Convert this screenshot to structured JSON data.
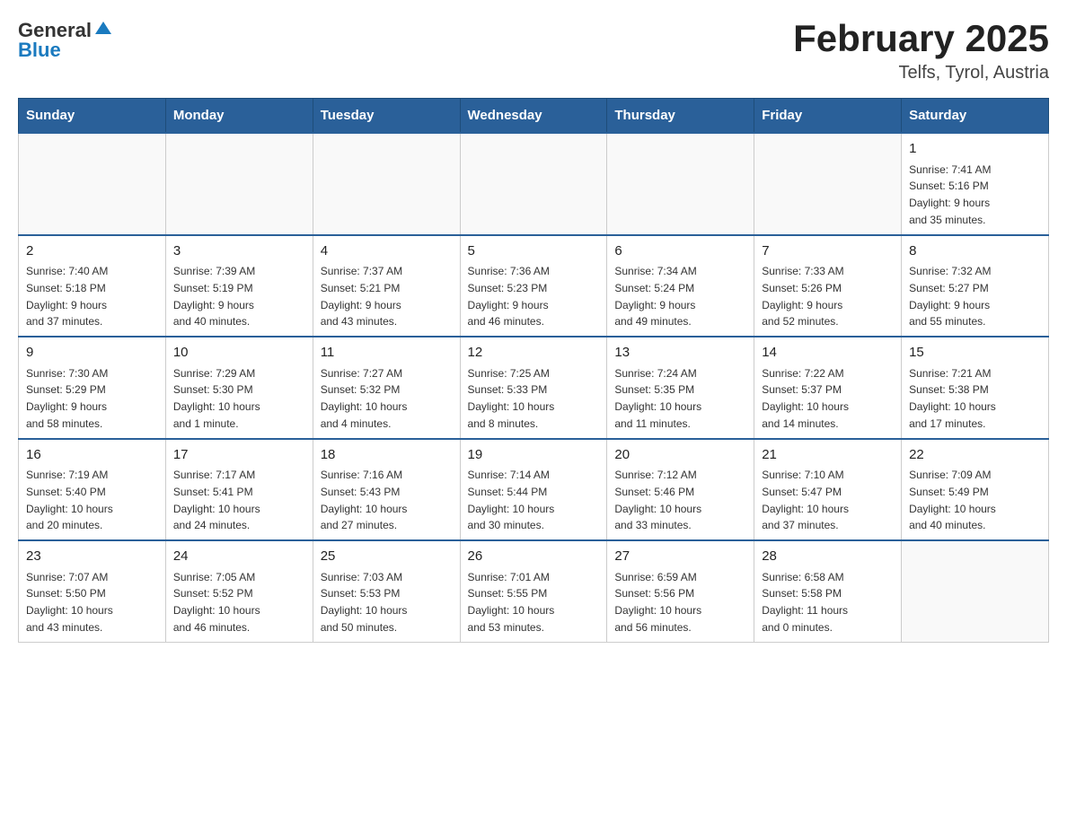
{
  "header": {
    "logo": {
      "general": "General",
      "blue": "Blue"
    },
    "title": "February 2025",
    "location": "Telfs, Tyrol, Austria"
  },
  "days_of_week": [
    "Sunday",
    "Monday",
    "Tuesday",
    "Wednesday",
    "Thursday",
    "Friday",
    "Saturday"
  ],
  "weeks": [
    [
      {
        "day": "",
        "info": ""
      },
      {
        "day": "",
        "info": ""
      },
      {
        "day": "",
        "info": ""
      },
      {
        "day": "",
        "info": ""
      },
      {
        "day": "",
        "info": ""
      },
      {
        "day": "",
        "info": ""
      },
      {
        "day": "1",
        "info": "Sunrise: 7:41 AM\nSunset: 5:16 PM\nDaylight: 9 hours\nand 35 minutes."
      }
    ],
    [
      {
        "day": "2",
        "info": "Sunrise: 7:40 AM\nSunset: 5:18 PM\nDaylight: 9 hours\nand 37 minutes."
      },
      {
        "day": "3",
        "info": "Sunrise: 7:39 AM\nSunset: 5:19 PM\nDaylight: 9 hours\nand 40 minutes."
      },
      {
        "day": "4",
        "info": "Sunrise: 7:37 AM\nSunset: 5:21 PM\nDaylight: 9 hours\nand 43 minutes."
      },
      {
        "day": "5",
        "info": "Sunrise: 7:36 AM\nSunset: 5:23 PM\nDaylight: 9 hours\nand 46 minutes."
      },
      {
        "day": "6",
        "info": "Sunrise: 7:34 AM\nSunset: 5:24 PM\nDaylight: 9 hours\nand 49 minutes."
      },
      {
        "day": "7",
        "info": "Sunrise: 7:33 AM\nSunset: 5:26 PM\nDaylight: 9 hours\nand 52 minutes."
      },
      {
        "day": "8",
        "info": "Sunrise: 7:32 AM\nSunset: 5:27 PM\nDaylight: 9 hours\nand 55 minutes."
      }
    ],
    [
      {
        "day": "9",
        "info": "Sunrise: 7:30 AM\nSunset: 5:29 PM\nDaylight: 9 hours\nand 58 minutes."
      },
      {
        "day": "10",
        "info": "Sunrise: 7:29 AM\nSunset: 5:30 PM\nDaylight: 10 hours\nand 1 minute."
      },
      {
        "day": "11",
        "info": "Sunrise: 7:27 AM\nSunset: 5:32 PM\nDaylight: 10 hours\nand 4 minutes."
      },
      {
        "day": "12",
        "info": "Sunrise: 7:25 AM\nSunset: 5:33 PM\nDaylight: 10 hours\nand 8 minutes."
      },
      {
        "day": "13",
        "info": "Sunrise: 7:24 AM\nSunset: 5:35 PM\nDaylight: 10 hours\nand 11 minutes."
      },
      {
        "day": "14",
        "info": "Sunrise: 7:22 AM\nSunset: 5:37 PM\nDaylight: 10 hours\nand 14 minutes."
      },
      {
        "day": "15",
        "info": "Sunrise: 7:21 AM\nSunset: 5:38 PM\nDaylight: 10 hours\nand 17 minutes."
      }
    ],
    [
      {
        "day": "16",
        "info": "Sunrise: 7:19 AM\nSunset: 5:40 PM\nDaylight: 10 hours\nand 20 minutes."
      },
      {
        "day": "17",
        "info": "Sunrise: 7:17 AM\nSunset: 5:41 PM\nDaylight: 10 hours\nand 24 minutes."
      },
      {
        "day": "18",
        "info": "Sunrise: 7:16 AM\nSunset: 5:43 PM\nDaylight: 10 hours\nand 27 minutes."
      },
      {
        "day": "19",
        "info": "Sunrise: 7:14 AM\nSunset: 5:44 PM\nDaylight: 10 hours\nand 30 minutes."
      },
      {
        "day": "20",
        "info": "Sunrise: 7:12 AM\nSunset: 5:46 PM\nDaylight: 10 hours\nand 33 minutes."
      },
      {
        "day": "21",
        "info": "Sunrise: 7:10 AM\nSunset: 5:47 PM\nDaylight: 10 hours\nand 37 minutes."
      },
      {
        "day": "22",
        "info": "Sunrise: 7:09 AM\nSunset: 5:49 PM\nDaylight: 10 hours\nand 40 minutes."
      }
    ],
    [
      {
        "day": "23",
        "info": "Sunrise: 7:07 AM\nSunset: 5:50 PM\nDaylight: 10 hours\nand 43 minutes."
      },
      {
        "day": "24",
        "info": "Sunrise: 7:05 AM\nSunset: 5:52 PM\nDaylight: 10 hours\nand 46 minutes."
      },
      {
        "day": "25",
        "info": "Sunrise: 7:03 AM\nSunset: 5:53 PM\nDaylight: 10 hours\nand 50 minutes."
      },
      {
        "day": "26",
        "info": "Sunrise: 7:01 AM\nSunset: 5:55 PM\nDaylight: 10 hours\nand 53 minutes."
      },
      {
        "day": "27",
        "info": "Sunrise: 6:59 AM\nSunset: 5:56 PM\nDaylight: 10 hours\nand 56 minutes."
      },
      {
        "day": "28",
        "info": "Sunrise: 6:58 AM\nSunset: 5:58 PM\nDaylight: 11 hours\nand 0 minutes."
      },
      {
        "day": "",
        "info": ""
      }
    ]
  ]
}
